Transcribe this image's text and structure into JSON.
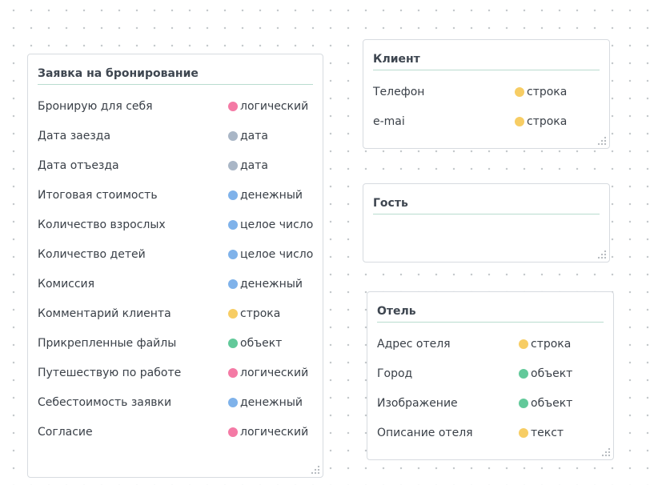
{
  "colors": {
    "логический": "#f47aa5",
    "дата": "#a9b6c6",
    "денежный": "#7fb2ea",
    "целое число": "#7fb2ea",
    "строка": "#f7cd64",
    "объект": "#62c99a",
    "текст": "#f7cd64"
  },
  "entities": [
    {
      "id": "booking",
      "title": "Заявка на бронирование",
      "fields": [
        {
          "name": "Бронирую для себя",
          "type": "логический"
        },
        {
          "name": "Дата заезда",
          "type": "дата"
        },
        {
          "name": "Дата отъезда",
          "type": "дата"
        },
        {
          "name": "Итоговая стоимость",
          "type": "денежный"
        },
        {
          "name": "Количество взрослых",
          "type": "целое число"
        },
        {
          "name": "Количество детей",
          "type": "целое число"
        },
        {
          "name": "Комиссия",
          "type": "денежный"
        },
        {
          "name": "Комментарий клиента",
          "type": "строка"
        },
        {
          "name": "Прикрепленные файлы",
          "type": "объект"
        },
        {
          "name": "Путешествую по работе",
          "type": "логический"
        },
        {
          "name": "Себестоимость заявки",
          "type": "денежный"
        },
        {
          "name": "Согласие",
          "type": "логический"
        }
      ]
    },
    {
      "id": "client",
      "title": "Клиент",
      "fields": [
        {
          "name": "Телефон",
          "type": "строка"
        },
        {
          "name": "e-mai",
          "type": "строка"
        }
      ]
    },
    {
      "id": "guest",
      "title": "Гость",
      "fields": []
    },
    {
      "id": "hotel",
      "title": "Отель",
      "fields": [
        {
          "name": "Адрес отеля",
          "type": "строка"
        },
        {
          "name": "Город",
          "type": "объект"
        },
        {
          "name": "Изображение",
          "type": "объект"
        },
        {
          "name": "Описание отеля",
          "type": "текст"
        }
      ]
    }
  ]
}
